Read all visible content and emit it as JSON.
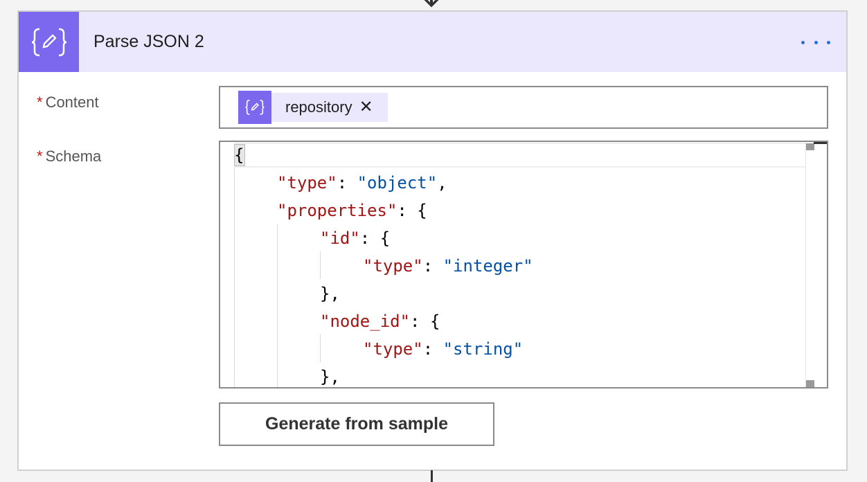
{
  "card": {
    "title": "Parse JSON 2",
    "icon": "json-edit-icon"
  },
  "fields": {
    "content": {
      "required_mark": "*",
      "label": "Content",
      "token": {
        "label": "repository",
        "close": "✕",
        "icon": "json-edit-icon"
      }
    },
    "schema": {
      "required_mark": "*",
      "label": "Schema"
    }
  },
  "schema_code": {
    "lines": [
      {
        "indent": 0,
        "parts": [
          [
            "p",
            "{"
          ]
        ]
      },
      {
        "indent": 1,
        "parts": [
          [
            "k",
            "\"type\""
          ],
          [
            "p",
            ": "
          ],
          [
            "s",
            "\"object\""
          ],
          [
            "p",
            ","
          ]
        ]
      },
      {
        "indent": 1,
        "parts": [
          [
            "k",
            "\"properties\""
          ],
          [
            "p",
            ": {"
          ]
        ]
      },
      {
        "indent": 2,
        "parts": [
          [
            "k",
            "\"id\""
          ],
          [
            "p",
            ": {"
          ]
        ]
      },
      {
        "indent": 3,
        "parts": [
          [
            "k",
            "\"type\""
          ],
          [
            "p",
            ": "
          ],
          [
            "s",
            "\"integer\""
          ]
        ]
      },
      {
        "indent": 2,
        "parts": [
          [
            "p",
            "},"
          ]
        ]
      },
      {
        "indent": 2,
        "parts": [
          [
            "k",
            "\"node_id\""
          ],
          [
            "p",
            ": {"
          ]
        ]
      },
      {
        "indent": 3,
        "parts": [
          [
            "k",
            "\"type\""
          ],
          [
            "p",
            ": "
          ],
          [
            "s",
            "\"string\""
          ]
        ]
      },
      {
        "indent": 2,
        "parts": [
          [
            "p",
            "},"
          ]
        ]
      }
    ]
  },
  "actions": {
    "generate_label": "Generate from sample"
  },
  "colors": {
    "accent": "#7b68ee",
    "header_bg": "#ebe8fe",
    "key": "#a31515",
    "string": "#0451a5",
    "more_dots": "#2b6fd6",
    "required": "#c41a1a"
  }
}
